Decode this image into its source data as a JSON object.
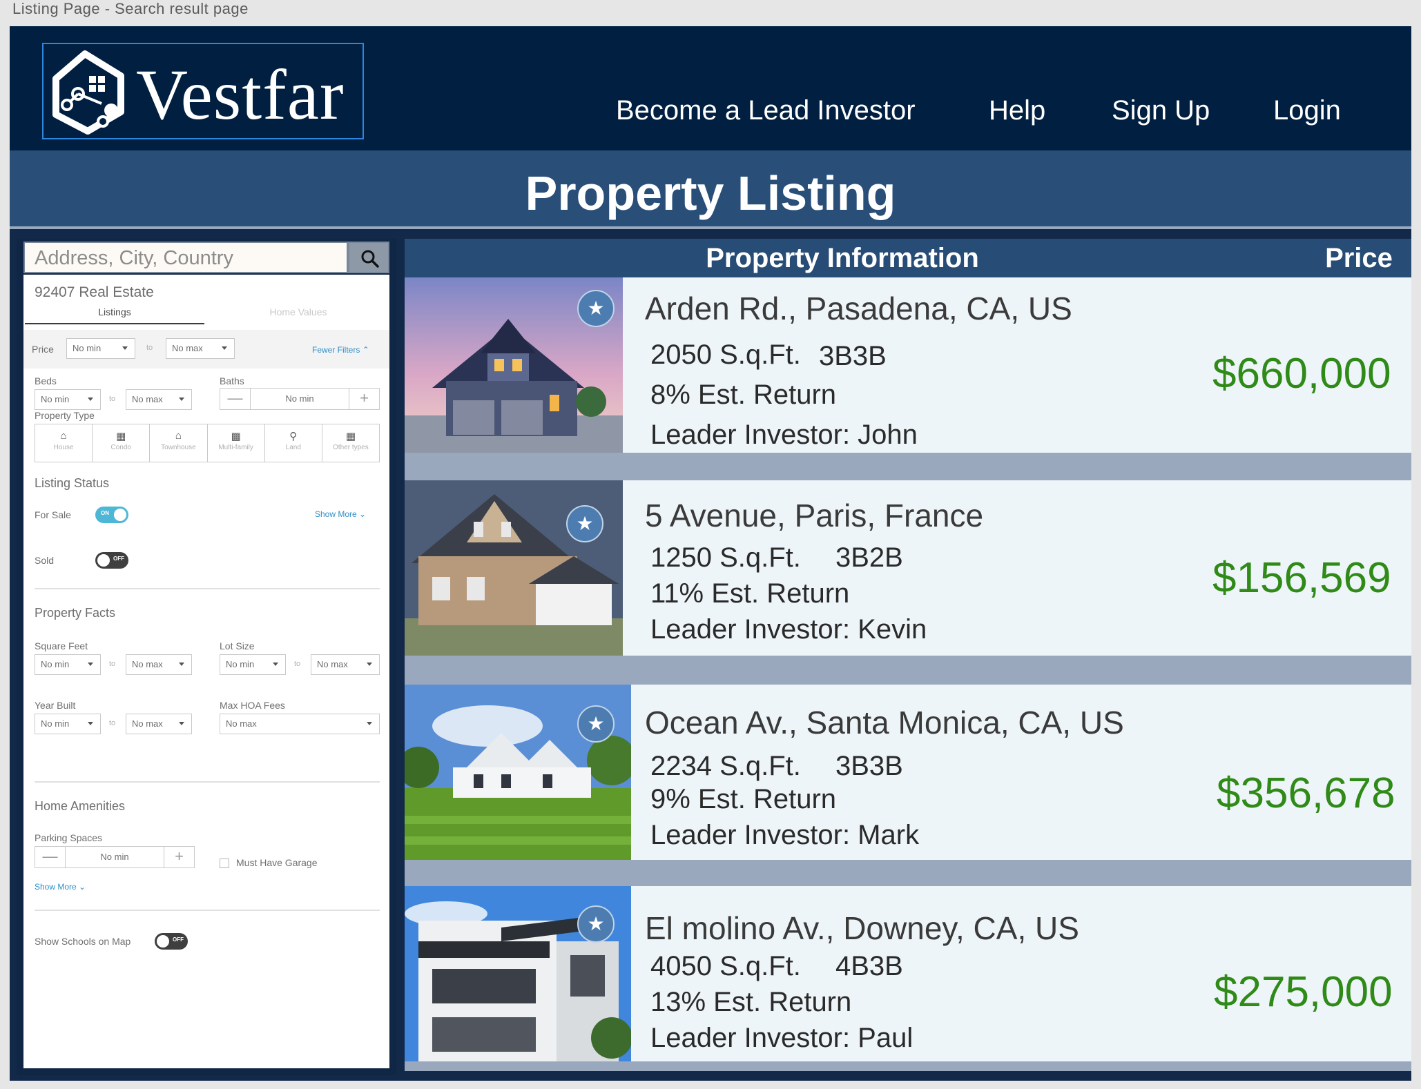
{
  "page_caption": "Listing Page - Search result page",
  "header": {
    "logo_text": "Vestfar",
    "nav": [
      "Become a Lead Investor",
      "Help",
      "Sign Up",
      "Login"
    ]
  },
  "banner_title": "Property Listing",
  "search": {
    "placeholder": "Address, City, Country"
  },
  "filters": {
    "area_title": "92407 Real Estate",
    "tabs": [
      "Listings",
      "Home Values"
    ],
    "price_label": "Price",
    "price_min": "No min",
    "price_max": "No max",
    "to": "to",
    "fewer_filters": "Fewer Filters",
    "beds_label": "Beds",
    "beds_min": "No min",
    "beds_max": "No max",
    "baths_label": "Baths",
    "baths_value": "No min",
    "property_type_label": "Property Type",
    "property_types": [
      "House",
      "Condo",
      "Townhouse",
      "Multi-family",
      "Land",
      "Other types"
    ],
    "listing_status_label": "Listing Status",
    "for_sale_label": "For Sale",
    "for_sale_toggle": "ON",
    "show_more": "Show More",
    "sold_label": "Sold",
    "sold_toggle": "OFF",
    "property_facts_label": "Property Facts",
    "square_feet_label": "Square Feet",
    "sqft_min": "No min",
    "sqft_max": "No max",
    "lot_size_label": "Lot Size",
    "lot_min": "No min",
    "lot_max": "No max",
    "year_built_label": "Year Built",
    "year_min": "No min",
    "year_max": "No max",
    "hoa_label": "Max HOA Fees",
    "hoa_value": "No max",
    "home_amenities_label": "Home Amenities",
    "parking_label": "Parking Spaces",
    "parking_value": "No min",
    "must_have_garage": "Must Have Garage",
    "show_more_2": "Show More",
    "show_schools_label": "Show Schools on Map",
    "show_schools_toggle": "OFF"
  },
  "listing_header": {
    "info": "Property Information",
    "price": "Price"
  },
  "properties": [
    {
      "address": "Arden Rd., Pasadena, CA, US",
      "sqft": "2050 S.q.Ft.",
      "rooms": "3B3B",
      "est_return": "8% Est. Return",
      "leader": "Leader Investor: John",
      "price": "$660,000"
    },
    {
      "address": "5 Avenue, Paris, France",
      "sqft": "1250 S.q.Ft.",
      "rooms": "3B2B",
      "est_return": "11% Est. Return",
      "leader": "Leader Investor: Kevin",
      "price": "$156,569"
    },
    {
      "address": "Ocean Av., Santa Monica, CA, US",
      "sqft": "2234 S.q.Ft.",
      "rooms": "3B3B",
      "est_return": "9% Est. Return",
      "leader": "Leader Investor: Mark",
      "price": "$356,678"
    },
    {
      "address": "El molino Av., Downey, CA, US",
      "sqft": "4050 S.q.Ft.",
      "rooms": "4B3B",
      "est_return": "13% Est. Return",
      "leader": "Leader Investor: Paul",
      "price": "$275,000"
    }
  ],
  "colors": {
    "header_bg": "#011f40",
    "banner_bg": "#294f79",
    "price_green": "#2f8a17",
    "card_bg": "#eef5f9",
    "separator": "#9aa8bd"
  },
  "icons": {
    "favorite": "star-icon",
    "search": "search-icon",
    "logo": "house-network-icon"
  }
}
